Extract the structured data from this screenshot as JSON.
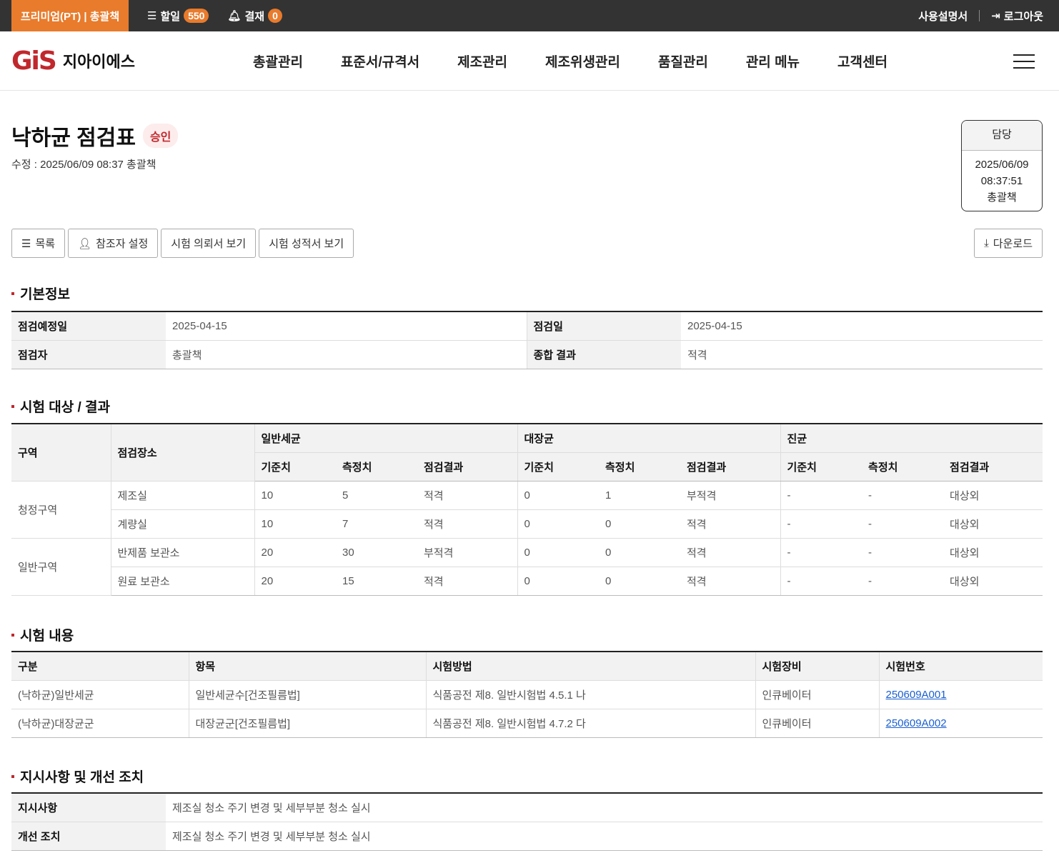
{
  "topbar": {
    "plan": "프리미엄(PT) | 총괄책",
    "todo_label": "할일",
    "todo_count": "550",
    "approval_label": "결재",
    "approval_count": "0",
    "manual": "사용설명서",
    "logout": "로그아웃"
  },
  "header": {
    "logo_mark": "GiS",
    "logo_text": "지아이에스",
    "nav": [
      "총괄관리",
      "표준서/규격서",
      "제조관리",
      "제조위생관리",
      "품질관리",
      "관리 메뉴",
      "고객센터"
    ]
  },
  "page": {
    "title": "낙하균 점검표",
    "status": "승인",
    "modified": "수정 : 2025/06/09 08:37  총괄책"
  },
  "approver": {
    "role": "담당",
    "date": "2025/06/09",
    "time": "08:37:51",
    "name": "총괄책"
  },
  "buttons": {
    "list": "목록",
    "participants": "참조자 설정",
    "request": "시험 의뢰서 보기",
    "report": "시험 성적서 보기",
    "download": "다운로드"
  },
  "basic": {
    "title": "기본정보",
    "scheduled_label": "점검예정일",
    "scheduled": "2025-04-15",
    "date_label": "점검일",
    "date": "2025-04-15",
    "inspector_label": "점검자",
    "inspector": "총괄책",
    "result_label": "종합 결과",
    "result": "적격"
  },
  "tests": {
    "title": "시험 대상 / 결과",
    "h_area": "구역",
    "h_place": "점검장소",
    "groups": [
      "일반세균",
      "대장균",
      "진균"
    ],
    "sub": [
      "기준치",
      "측정치",
      "점검결과"
    ],
    "areas": [
      {
        "name": "청정구역",
        "rows": [
          [
            "제조실",
            "10",
            "5",
            "적격",
            "0",
            "1",
            "부적격",
            "-",
            "-",
            "대상외"
          ],
          [
            "계량실",
            "10",
            "7",
            "적격",
            "0",
            "0",
            "적격",
            "-",
            "-",
            "대상외"
          ]
        ]
      },
      {
        "name": "일반구역",
        "rows": [
          [
            "반제품 보관소",
            "20",
            "30",
            "부적격",
            "0",
            "0",
            "적격",
            "-",
            "-",
            "대상외"
          ],
          [
            "원료 보관소",
            "20",
            "15",
            "적격",
            "0",
            "0",
            "적격",
            "-",
            "-",
            "대상외"
          ]
        ]
      }
    ]
  },
  "content": {
    "title": "시험 내용",
    "headers": [
      "구분",
      "항목",
      "시험방법",
      "시험장비",
      "시험번호"
    ],
    "rows": [
      [
        "(낙하균)일반세균",
        "일반세균수[건조필름법]",
        "식품공전 제8. 일반시험법 4.5.1 나",
        "인큐베이터",
        "250609A001"
      ],
      [
        "(낙하균)대장균군",
        "대장균군[건조필름법]",
        "식품공전 제8. 일반시험법 4.7.2 다",
        "인큐베이터",
        "250609A002"
      ]
    ]
  },
  "actions": {
    "title": "지시사항 및 개선 조치",
    "instr_label": "지시사항",
    "instr": "제조실 청소 주기 변경 및 세부부분 청소 실시",
    "improve_label": "개선 조치",
    "improve": "제조실 청소 주기 변경 및 세부부분 청소 실시"
  }
}
